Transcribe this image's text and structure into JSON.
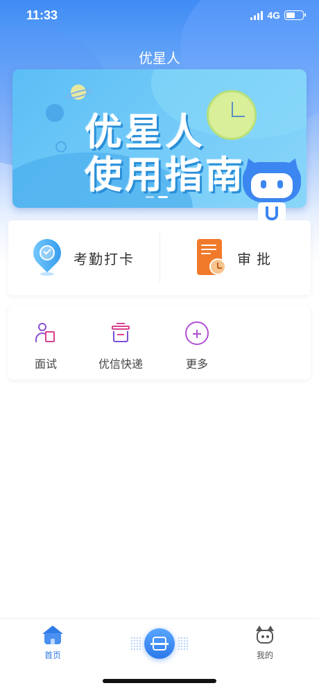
{
  "status_bar": {
    "time": "11:33",
    "network": "4G"
  },
  "header": {
    "title": "优星人"
  },
  "banner": {
    "line1": "优星人",
    "line2": "使用指南",
    "slides": 2,
    "active_slide": 2
  },
  "primary_actions": [
    {
      "label": "考勤打卡",
      "icon": "location-check-icon"
    },
    {
      "label": "审批",
      "icon": "document-clock-icon"
    }
  ],
  "tools": [
    {
      "label": "面试",
      "icon": "interview-person-icon"
    },
    {
      "label": "优信快递",
      "icon": "express-box-icon"
    },
    {
      "label": "更多",
      "icon": "plus-circle-icon"
    }
  ],
  "tabbar": {
    "home_label": "首页",
    "mine_label": "我的",
    "active": "首页",
    "accent_color": "#2f7be8"
  }
}
